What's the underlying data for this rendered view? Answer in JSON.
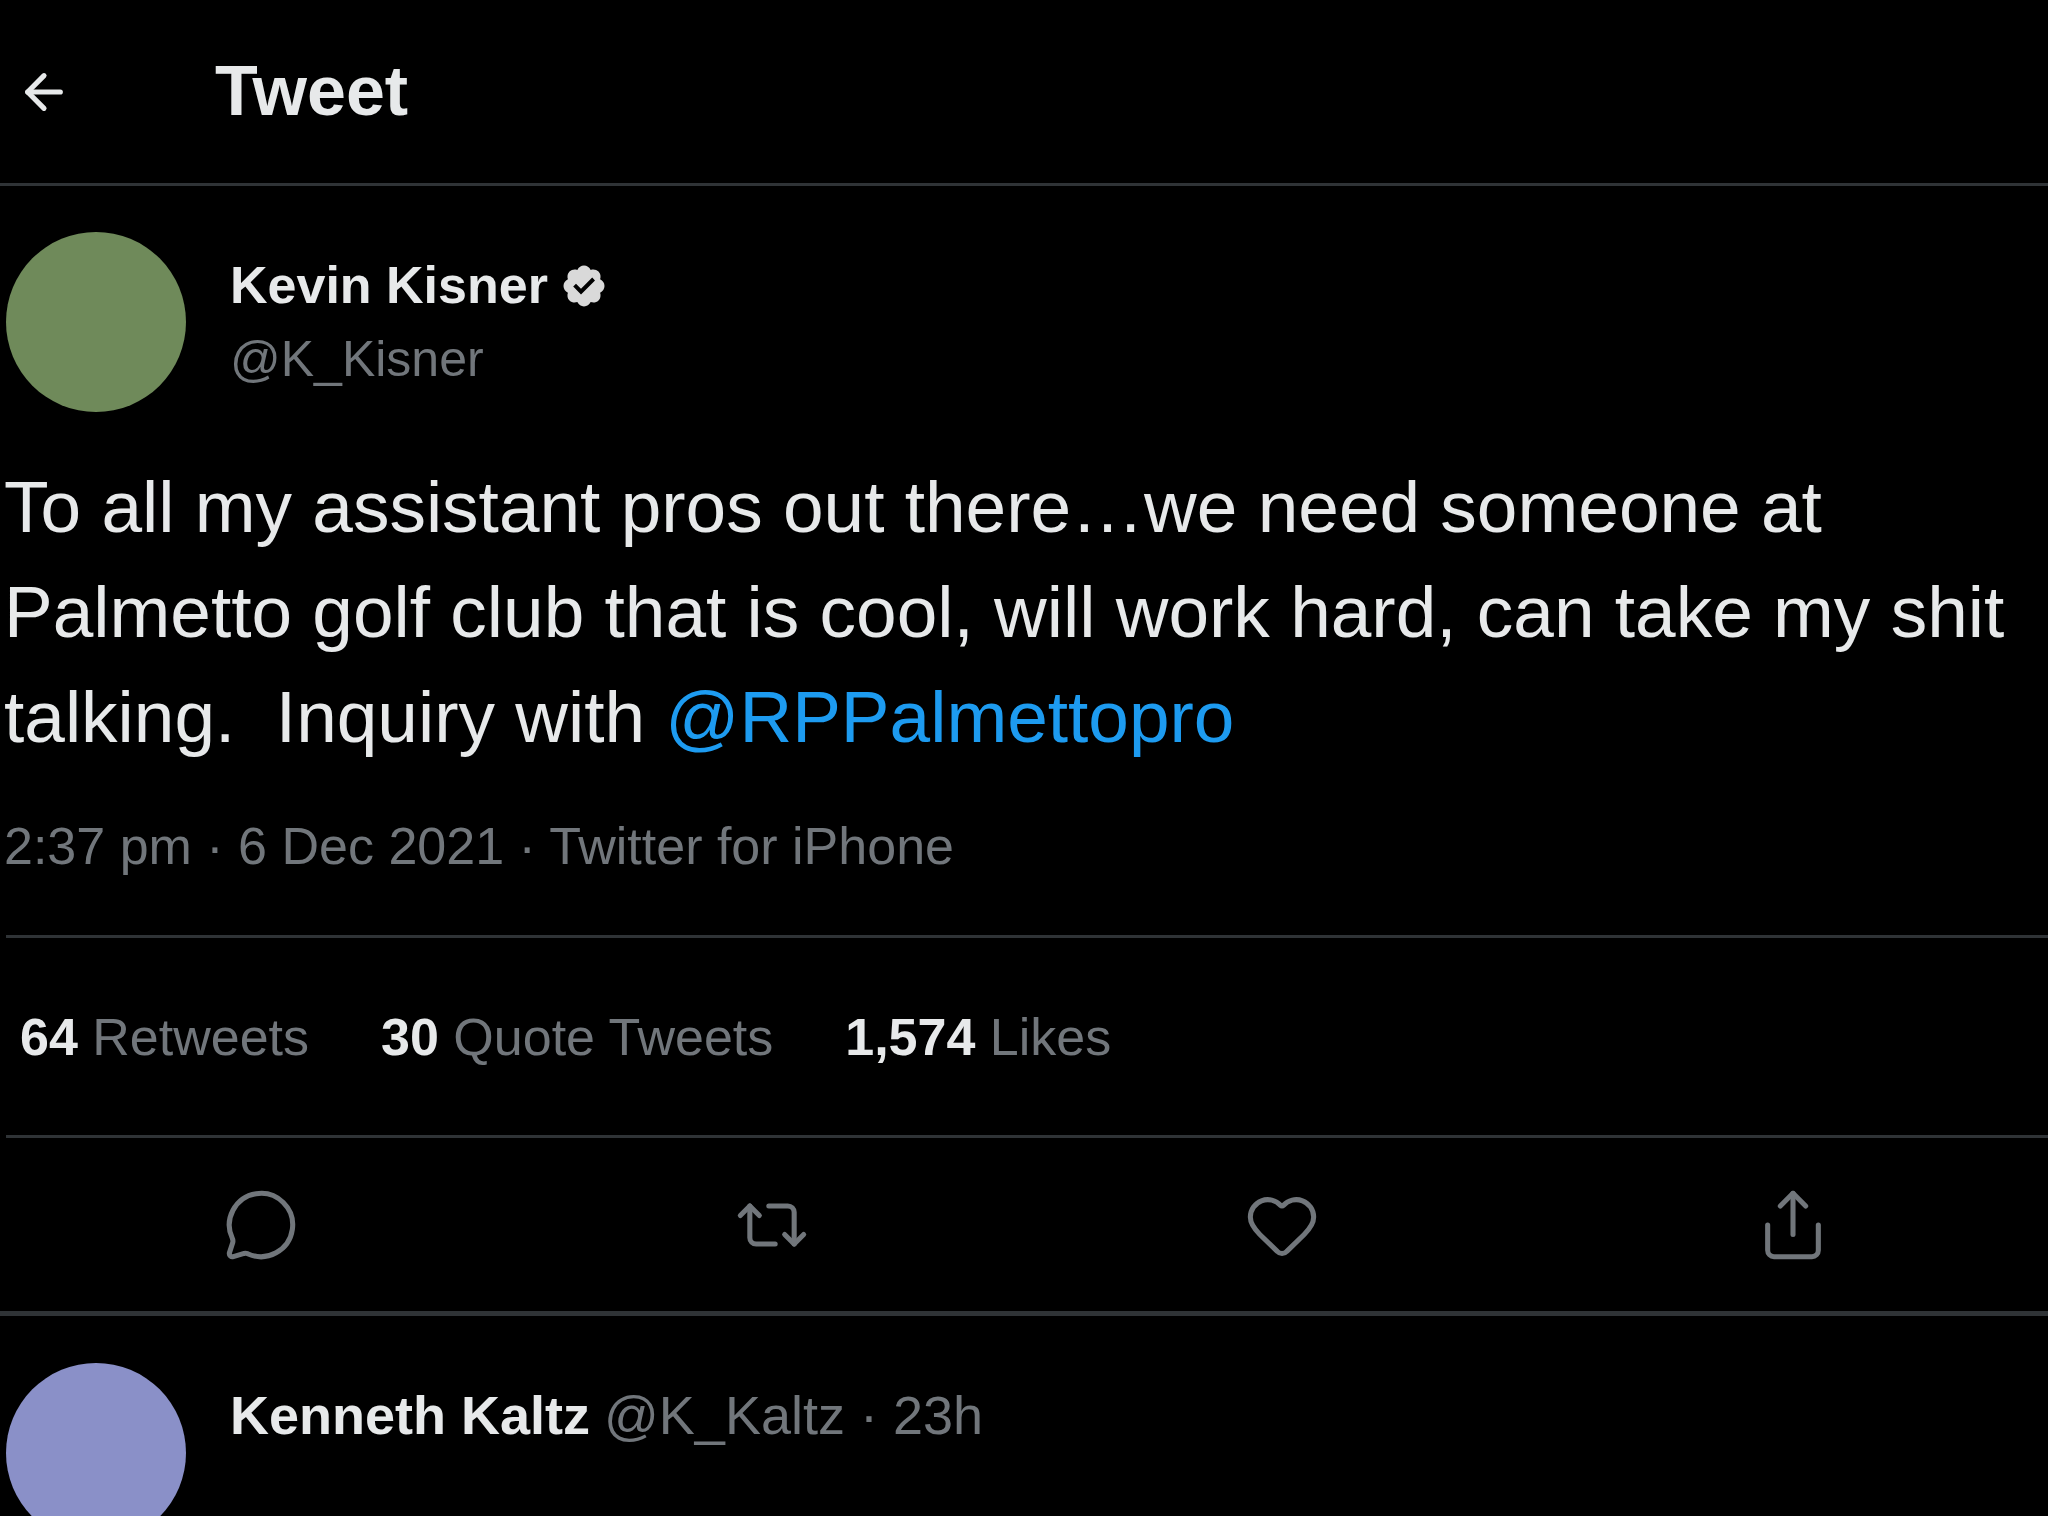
{
  "header": {
    "title": "Tweet"
  },
  "tweet": {
    "author": {
      "name": "Kevin Kisner",
      "verified": true,
      "handle": "@K_Kisner"
    },
    "text": "To all my assistant pros out there…we need someone at Palmetto golf club that is cool, will work hard, can take my shit talking.  Inquiry with",
    "mention": "@RPPalmettopro",
    "meta": "2:37 pm · 6 Dec 2021 · Twitter for iPhone",
    "stats": [
      "**64** Retweets",
      "**30** Quote Tweets",
      "**1,574** Likes"
    ],
    "actions": [
      {
        "kind": "reply"
      },
      {
        "kind": "retweet"
      },
      {
        "kind": "like"
      },
      {
        "kind": "share"
      }
    ]
  },
  "replies": [
    {
      "name": "Kenneth Kaltz",
      "meta": "@K_Kaltz · 23h"
    }
  ]
}
